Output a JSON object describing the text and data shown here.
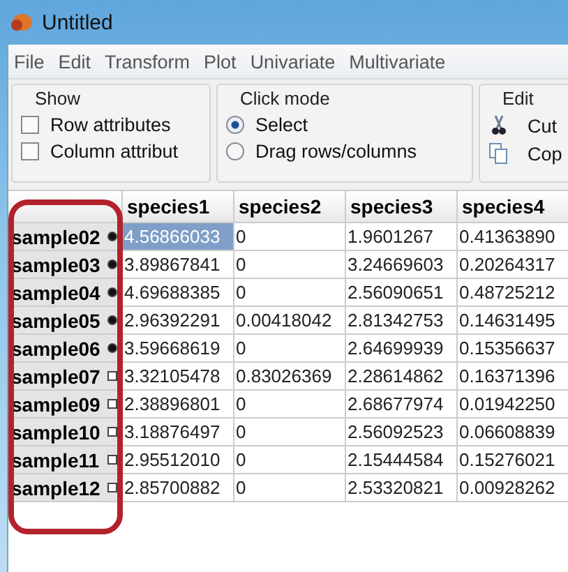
{
  "window": {
    "title": "Untitled"
  },
  "menu": [
    "File",
    "Edit",
    "Transform",
    "Plot",
    "Univariate",
    "Multivariate"
  ],
  "show": {
    "title": "Show",
    "options": [
      {
        "label": "Row attributes",
        "checked": false
      },
      {
        "label": "Column attribut",
        "checked": false
      }
    ]
  },
  "click_mode": {
    "title": "Click mode",
    "options": [
      {
        "label": "Select",
        "selected": true
      },
      {
        "label": "Drag rows/columns",
        "selected": false
      }
    ]
  },
  "edit": {
    "title": "Edit",
    "actions": [
      {
        "label": "Cut",
        "kind": "cut"
      },
      {
        "label": "Cop",
        "kind": "copy"
      }
    ]
  },
  "table": {
    "columns": [
      "species1",
      "species2",
      "species3",
      "species4"
    ],
    "rows": [
      {
        "name": "sample02",
        "marked": true,
        "cells": [
          {
            "text": "4.56866033",
            "selected": true
          },
          {
            "text": "0",
            "selected": false
          },
          {
            "text": "1.9601267",
            "selected": false
          },
          {
            "text": "0.41363890",
            "selected": false
          }
        ]
      },
      {
        "name": "sample03",
        "marked": true,
        "cells": [
          {
            "text": "3.89867841",
            "selected": false
          },
          {
            "text": "0",
            "selected": false
          },
          {
            "text": "3.24669603",
            "selected": false
          },
          {
            "text": "0.20264317",
            "selected": false
          }
        ]
      },
      {
        "name": "sample04",
        "marked": true,
        "cells": [
          {
            "text": "4.69688385",
            "selected": false
          },
          {
            "text": "0",
            "selected": false
          },
          {
            "text": "2.56090651",
            "selected": false
          },
          {
            "text": "0.48725212",
            "selected": false
          }
        ]
      },
      {
        "name": "sample05",
        "marked": true,
        "cells": [
          {
            "text": "2.96392291",
            "selected": false
          },
          {
            "text": "0.00418042",
            "selected": false
          },
          {
            "text": "2.81342753",
            "selected": false
          },
          {
            "text": "0.14631495",
            "selected": false
          }
        ]
      },
      {
        "name": "sample06",
        "marked": true,
        "cells": [
          {
            "text": "3.59668619",
            "selected": false
          },
          {
            "text": "0",
            "selected": false
          },
          {
            "text": "2.64699939",
            "selected": false
          },
          {
            "text": "0.15356637",
            "selected": false
          }
        ]
      },
      {
        "name": "sample07",
        "marked": false,
        "cells": [
          {
            "text": "3.32105478",
            "selected": false
          },
          {
            "text": "0.83026369",
            "selected": false
          },
          {
            "text": "2.28614862",
            "selected": false
          },
          {
            "text": "0.16371396",
            "selected": false
          }
        ]
      },
      {
        "name": "sample09",
        "marked": false,
        "cells": [
          {
            "text": "2.38896801",
            "selected": false
          },
          {
            "text": "0",
            "selected": false
          },
          {
            "text": "2.68677974",
            "selected": false
          },
          {
            "text": "0.01942250",
            "selected": false
          }
        ]
      },
      {
        "name": "sample10",
        "marked": false,
        "cells": [
          {
            "text": "3.18876497",
            "selected": false
          },
          {
            "text": "0",
            "selected": false
          },
          {
            "text": "2.56092523",
            "selected": false
          },
          {
            "text": "0.06608839",
            "selected": false
          }
        ]
      },
      {
        "name": "sample11",
        "marked": false,
        "cells": [
          {
            "text": "2.95512010",
            "selected": false
          },
          {
            "text": "0",
            "selected": false
          },
          {
            "text": "2.15444584",
            "selected": false
          },
          {
            "text": "0.15276021",
            "selected": false
          }
        ]
      },
      {
        "name": "sample12",
        "marked": false,
        "cells": [
          {
            "text": "2.85700882",
            "selected": false
          },
          {
            "text": "0",
            "selected": false
          },
          {
            "text": "2.53320821",
            "selected": false
          },
          {
            "text": "0.00928262",
            "selected": false
          }
        ]
      }
    ]
  }
}
